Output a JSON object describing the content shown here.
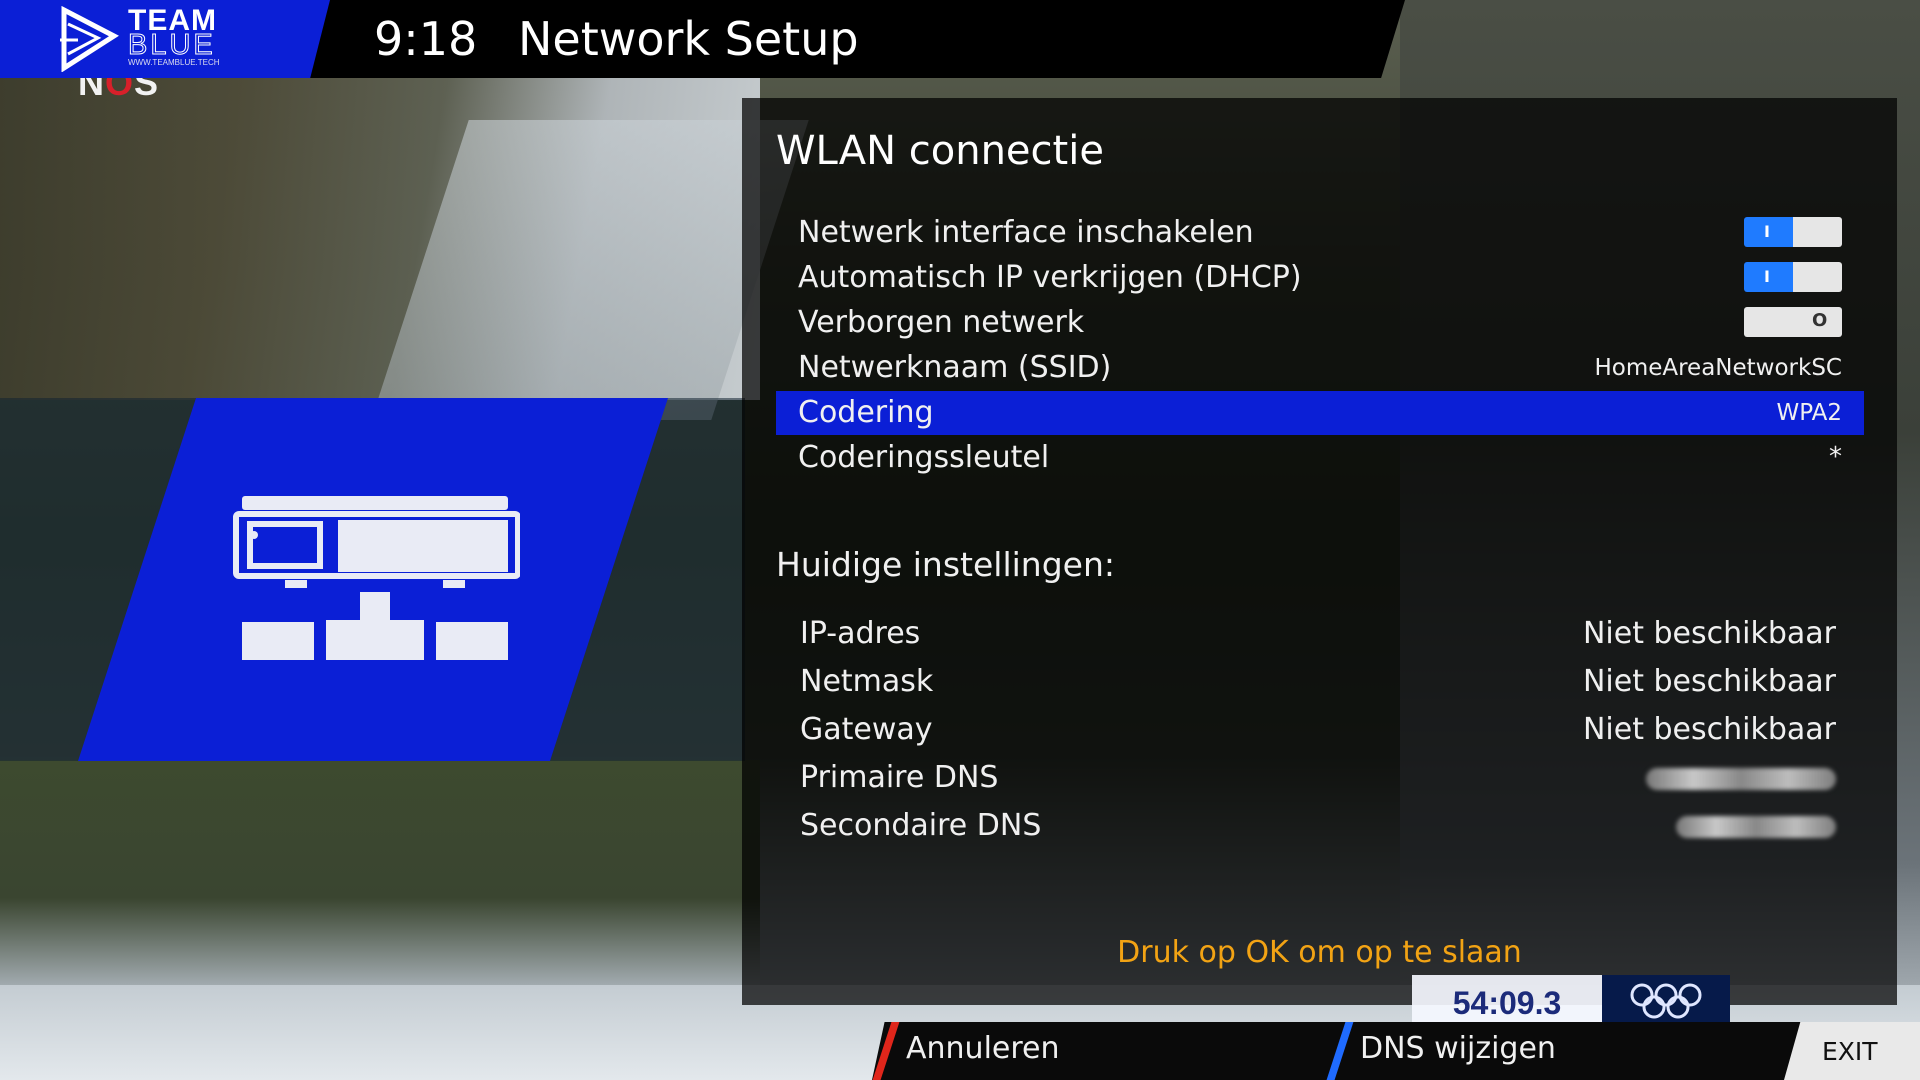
{
  "header": {
    "brand_line1": "TEAM",
    "brand_line2": "BLUE",
    "brand_url": "WWW.TEAMBLUE.TECH",
    "clock": "9:18",
    "title": "Network Setup"
  },
  "channel_logo": {
    "prefix": "N",
    "accent": "O",
    "suffix": "S"
  },
  "panel": {
    "title": "WLAN connectie",
    "settings": [
      {
        "label": "Netwerk interface inschakelen",
        "type": "toggle",
        "state": "on"
      },
      {
        "label": "Automatisch IP verkrijgen (DHCP)",
        "type": "toggle",
        "state": "on"
      },
      {
        "label": "Verborgen netwerk",
        "type": "toggle",
        "state": "off"
      },
      {
        "label": "Netwerknaam (SSID)",
        "type": "value",
        "value": "HomeAreaNetworkSC"
      },
      {
        "label": "Codering",
        "type": "value",
        "value": "WPA2",
        "selected": true
      },
      {
        "label": "Coderingssleutel",
        "type": "value",
        "value": "*"
      }
    ],
    "current_title": "Huidige instellingen:",
    "current": [
      {
        "label": "IP-adres",
        "value": "Niet beschikbaar"
      },
      {
        "label": "Netmask",
        "value": "Niet beschikbaar"
      },
      {
        "label": "Gateway",
        "value": "Niet beschikbaar"
      },
      {
        "label": "Primaire DNS",
        "value": "",
        "redacted": true
      },
      {
        "label": "Secondaire DNS",
        "value": "",
        "redacted": true
      }
    ],
    "hint": "Druk op OK om op te slaan"
  },
  "toggle_marks": {
    "on": "I",
    "off": "O"
  },
  "overlay": {
    "score": "54:09.3"
  },
  "buttons": {
    "red_label": "Annuleren",
    "blue_label": "DNS wijzigen",
    "exit_label": "EXIT"
  },
  "colors": {
    "brand_blue": "#0b1fd6",
    "selection_blue": "#0b1fd6",
    "toggle_on": "#1f7bff",
    "hint_orange": "#f2a314",
    "red_key": "#e0261b",
    "blue_key": "#1f6bff"
  },
  "icons": {
    "brand": "team-blue-logo",
    "network": "network-settings-icon",
    "olympic": "olympic-rings-icon"
  }
}
